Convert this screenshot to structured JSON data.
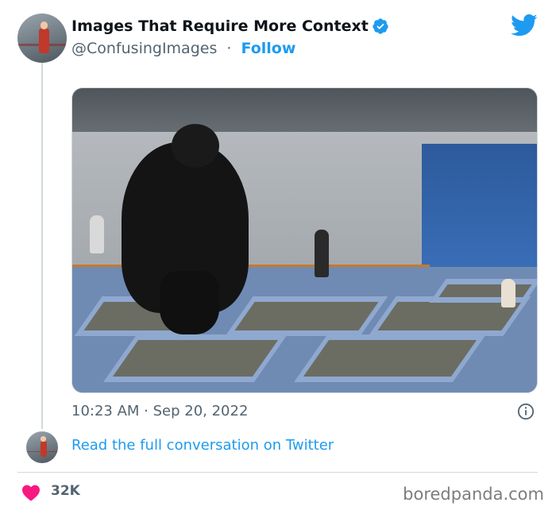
{
  "tweet": {
    "display_name": "Images That Require More Context",
    "handle": "@ConfusingImages",
    "separator": "·",
    "follow_label": "Follow",
    "timestamp": "10:23 AM · Sep 20, 2022",
    "conversation_link": "Read the full conversation on Twitter",
    "like_count": "32K"
  },
  "icons": {
    "verified": "verified-badge-icon",
    "platform": "twitter-bird-icon",
    "info": "info-icon",
    "like": "heart-icon"
  },
  "colors": {
    "accent": "#1d9bf0",
    "like": "#f91880",
    "secondary_text": "#536471"
  },
  "watermark": "boredpanda.com"
}
